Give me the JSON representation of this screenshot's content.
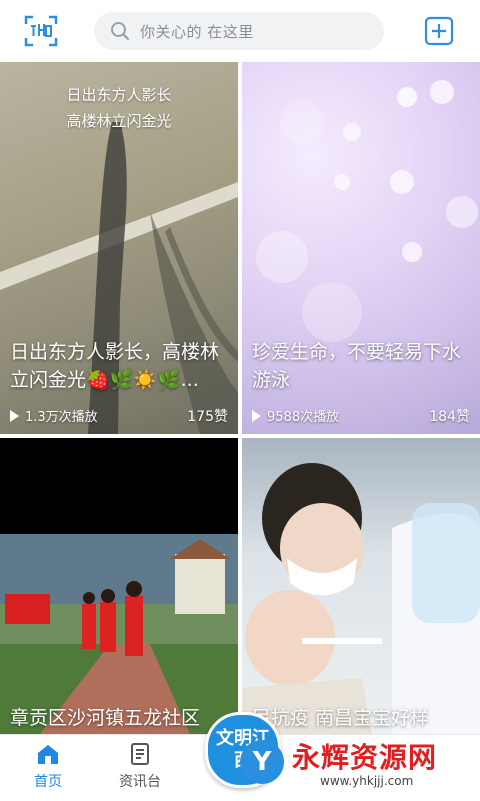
{
  "header": {
    "scan_icon": "scan-icon",
    "search_placeholder": "你关心的 在这里",
    "add_icon": "plus-icon"
  },
  "feed": [
    {
      "overlay_lines": [
        "日出东方人影长",
        "高楼林立闪金光"
      ],
      "caption": "日出东方人影长，高楼林立闪金光🍓🌿☀️🌿...",
      "plays": "1.3万次播放",
      "likes": "175赞"
    },
    {
      "caption": "珍爱生命，不要轻易下水游泳",
      "plays": "9588次播放",
      "likes": "184赞"
    },
    {
      "caption": "章贡区沙河镇五龙社区"
    },
    {
      "caption": "民抗疫 南昌宝宝好样"
    }
  ],
  "tabbar": {
    "items": [
      {
        "label": "首页",
        "icon": "home-icon",
        "active": true
      },
      {
        "label": "资讯台",
        "icon": "news-icon",
        "active": false
      }
    ],
    "center_badge": "文明江西"
  },
  "watermark": {
    "title": "永辉资源网",
    "url": "www.yhkjjj.com"
  },
  "colors": {
    "accent": "#1e88e5",
    "watermark_red": "#e02020"
  }
}
